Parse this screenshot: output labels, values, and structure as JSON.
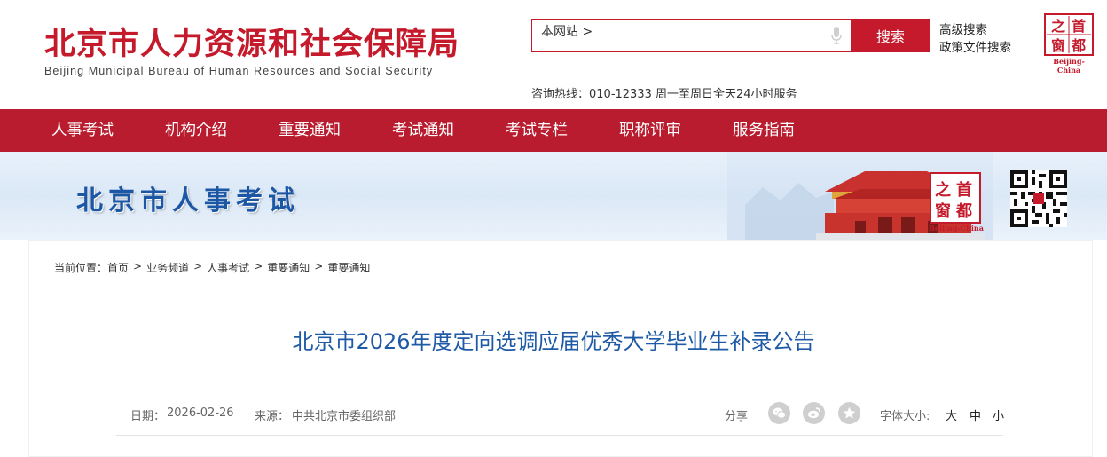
{
  "header": {
    "logo_cn": "北京市人力资源和社会保障局",
    "logo_en": "Beijing Municipal Bureau of Human Resources and Social Security",
    "search_scope": "本网站 >",
    "search_placeholder": "",
    "search_button": "搜索",
    "advanced_search": "高级搜索",
    "policy_search": "政策文件搜索",
    "hotline": "咨询热线：010-12333 周一至周日全天24小时服务",
    "seal_chars": [
      "之",
      "首",
      "窗",
      "都"
    ],
    "seal_caption": "Beijing-China"
  },
  "nav": {
    "items": [
      {
        "label": "人事考试"
      },
      {
        "label": "机构介绍"
      },
      {
        "label": "重要通知"
      },
      {
        "label": "考试通知"
      },
      {
        "label": "考试专栏"
      },
      {
        "label": "职称评审"
      },
      {
        "label": "服务指南"
      }
    ]
  },
  "banner": {
    "title": "北京市人事考试",
    "seal_chars": [
      "之",
      "首",
      "窗",
      "都"
    ],
    "seal_caption": "Beijing-China"
  },
  "breadcrumb": {
    "label": "当前位置：",
    "items": [
      "首页",
      "业务频道",
      "人事考试",
      "重要通知",
      "重要通知"
    ],
    "separator": ">"
  },
  "article": {
    "title": "北京市2026年度定向选调应届优秀大学毕业生补录公告",
    "date_label": "日期：",
    "date": "2026-02-26",
    "source_label": "来源：",
    "source": "中共北京市委组织部",
    "share_label": "分享",
    "share_icons": [
      "wechat-icon",
      "weibo-icon",
      "favorite-icon"
    ],
    "font_size_label": "字体大小:",
    "font_sizes": [
      "大",
      "中",
      "小"
    ]
  },
  "colors": {
    "brand_red": "#c41a2c",
    "nav_red": "#b91c2e",
    "title_blue": "#1f5aa6",
    "banner_blue": "#1c57a6"
  }
}
